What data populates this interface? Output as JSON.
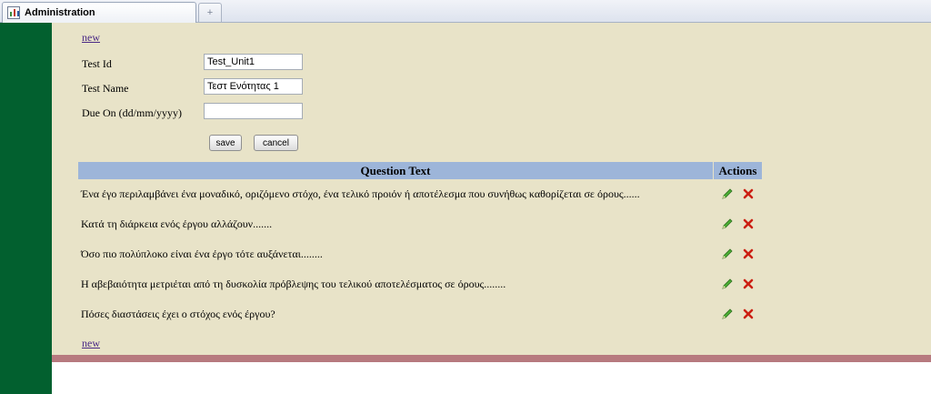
{
  "browser": {
    "tab_title": "Administration",
    "new_tab_glyph": "+",
    "tab_icon": "admin-chart-icon"
  },
  "page": {
    "new_link_top": "new",
    "new_link_bottom": "new",
    "colors": {
      "sidebar": "#02602f",
      "content_bg": "#e8e3c8",
      "table_header": "#9db5d9",
      "footer_bar": "#b77a7f",
      "edit_icon": "#3f9a2e",
      "delete_icon": "#cc1f12"
    }
  },
  "form": {
    "test_id_label": "Test Id",
    "test_id_value": "Test_Unit1",
    "test_name_label": "Test Name",
    "test_name_value": "Τεστ Ενότητας 1",
    "due_on_label": "Due On (dd/mm/yyyy)",
    "due_on_value": "",
    "save_label": "save",
    "cancel_label": "cancel"
  },
  "table": {
    "headers": [
      "Question Text",
      "Actions"
    ],
    "rows": [
      {
        "question": "Ένα έγο περιλαμβάνει ένα μοναδικό, οριζόμενο στόχο, ένα τελικό προιόν ή αποτέλεσμα που συνήθως καθορίζεται σε όρους......"
      },
      {
        "question": "Κατά τη διάρκεια ενός έργου αλλάζουν......."
      },
      {
        "question": "Όσο πιο πολύπλοκο είναι ένα έργο τότε αυξάνεται........"
      },
      {
        "question": "Η αβεβαιότητα μετριέται από τη δυσκολία πρόβλεψης του τελικού αποτελέσματος σε όρους........"
      },
      {
        "question": "Πόσες διαστάσεις έχει ο στόχος ενός έργου?"
      }
    ],
    "action_icons": [
      "pencil-edit-icon",
      "delete-x-icon"
    ]
  }
}
